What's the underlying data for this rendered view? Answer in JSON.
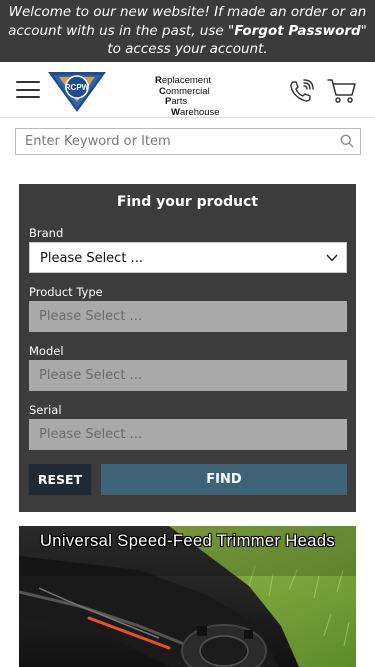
{
  "announcement": {
    "text_before": "Welcome to our new website! If made an order or an account with us in the past, use \"",
    "link": "Forgot Password",
    "text_after": "\" to access your account."
  },
  "header": {
    "logo_badge": "RCPW",
    "logo_lines": [
      {
        "initial": "R",
        "rest": "eplacement"
      },
      {
        "initial": "C",
        "rest": "ommercial"
      },
      {
        "initial": "P",
        "rest": "arts"
      },
      {
        "initial": "W",
        "rest": "arehouse"
      }
    ],
    "icons": {
      "menu": "hamburger-menu-icon",
      "phone": "phone-icon",
      "cart": "cart-icon"
    }
  },
  "search": {
    "placeholder": "Enter Keyword or Item",
    "icon": "search-icon"
  },
  "finder": {
    "title": "Find your product",
    "fields": [
      {
        "label": "Brand",
        "value": "Please Select ...",
        "enabled": true
      },
      {
        "label": "Product Type",
        "value": "Please Select ...",
        "enabled": false
      },
      {
        "label": "Model",
        "value": "Please Select ...",
        "enabled": false
      },
      {
        "label": "Serial",
        "value": "Please Select ...",
        "enabled": false
      }
    ],
    "reset_label": "RESET",
    "find_label": "FIND"
  },
  "banner": {
    "title": "Universal Speed-Feed Trimmer Heads"
  },
  "colors": {
    "announcement_bg": "#3b3b3b",
    "finder_bg": "#3c3c3c",
    "reset_bg": "#1e2b36",
    "find_bg": "#3e6379",
    "logo_blue": "#1f4d8c",
    "logo_orange": "#f0a23a"
  }
}
